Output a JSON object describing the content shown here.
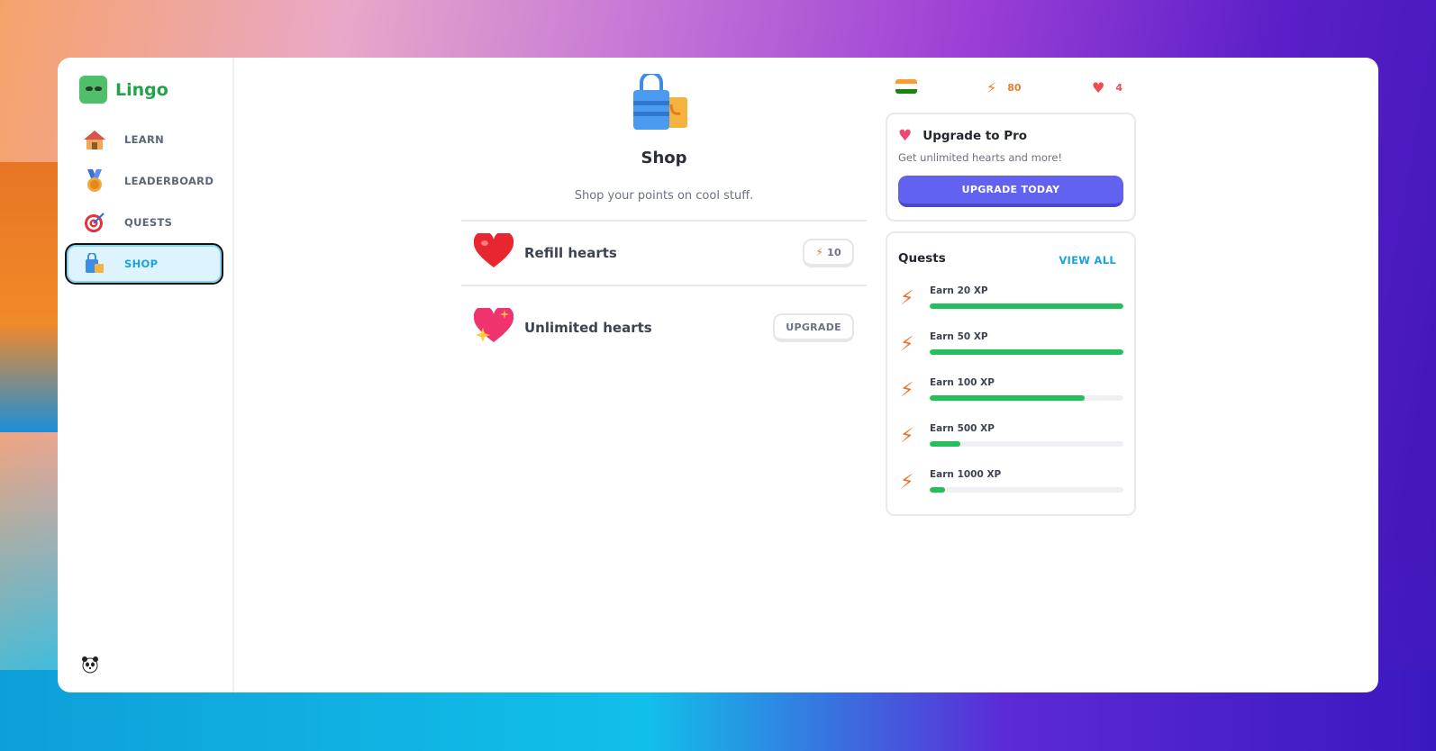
{
  "app": {
    "name": "Lingo"
  },
  "colors": {
    "brand_green": "#22a24a",
    "accent_blue": "#1aa3e0",
    "pro_purple": "#6262f0",
    "progress_green": "#22bf5a",
    "points_orange": "#f07b2c",
    "hearts_red": "#ef4c4c"
  },
  "sidebar": {
    "items": [
      {
        "label": "LEARN",
        "icon": "house-icon"
      },
      {
        "label": "LEADERBOARD",
        "icon": "medal-icon"
      },
      {
        "label": "QUESTS",
        "icon": "target-icon"
      },
      {
        "label": "SHOP",
        "icon": "shopping-bag-icon",
        "active": true
      }
    ],
    "user_icon": "panda-avatar-icon"
  },
  "shop": {
    "title": "Shop",
    "subtitle": "Shop your points on cool stuff.",
    "items": [
      {
        "label": "Refill hearts",
        "button": "10",
        "icon": "heart-icon"
      },
      {
        "label": "Unlimited hearts",
        "button": "UPGRADE",
        "icon": "sparkling-heart-icon"
      }
    ]
  },
  "stats": {
    "language_flag": "india-flag-icon",
    "points": "80",
    "hearts": "4"
  },
  "pro": {
    "title": "Upgrade to Pro",
    "subtitle": "Get unlimited hearts and more!",
    "button": "UPGRADE TODAY"
  },
  "quests": {
    "title": "Quests",
    "view_all": "VIEW ALL",
    "items": [
      {
        "label": "Earn 20 XP",
        "progress": 1.0
      },
      {
        "label": "Earn 50 XP",
        "progress": 1.0
      },
      {
        "label": "Earn 100 XP",
        "progress": 0.8
      },
      {
        "label": "Earn 500 XP",
        "progress": 0.16
      },
      {
        "label": "Earn 1000 XP",
        "progress": 0.08
      }
    ]
  }
}
